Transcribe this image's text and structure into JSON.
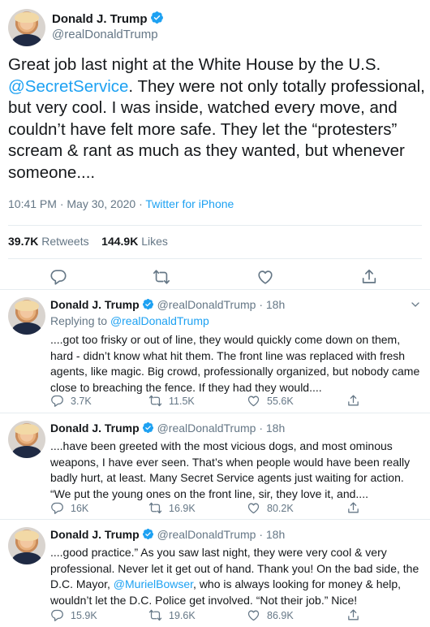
{
  "main_tweet": {
    "author_name": "Donald J. Trump",
    "author_handle": "@realDonaldTrump",
    "text_part1": "Great job last night at the White House by the U.S. ",
    "mention": "@SecretService",
    "text_part2": ". They were not only totally professional, but very cool. I was inside, watched every move, and couldn’t have felt more safe. They let the “protesters” scream & rant as much as they wanted, but whenever someone....",
    "timestamp": "10:41 PM · May 30, 2020 · ",
    "source": "Twitter for iPhone",
    "retweets_count": "39.7K",
    "retweets_label": "Retweets",
    "likes_count": "144.9K",
    "likes_label": "Likes"
  },
  "replies": [
    {
      "author_name": "Donald J. Trump",
      "author_handle": "@realDonaldTrump",
      "time": "18h",
      "replying_prefix": "Replying to ",
      "replying_handle": "@realDonaldTrump",
      "text": "....got too frisky or out of line, they would quickly come down on them, hard - didn’t know what hit them. The front line was replaced with fresh agents, like magic. Big crowd, professionally organized, but nobody came close to breaching the fence. If they had they would....",
      "reply_count": "3.7K",
      "retweet_count": "11.5K",
      "like_count": "55.6K"
    },
    {
      "author_name": "Donald J. Trump",
      "author_handle": "@realDonaldTrump",
      "time": "18h",
      "text": "....have been greeted with the most vicious dogs, and most ominous weapons, I have ever seen. That’s when people would have been really badly hurt, at least. Many Secret Service agents just waiting for action. “We put the young ones on the front line, sir, they love it, and....",
      "reply_count": "16K",
      "retweet_count": "16.9K",
      "like_count": "80.2K"
    },
    {
      "author_name": "Donald J. Trump",
      "author_handle": "@realDonaldTrump",
      "time": "18h",
      "text_part1": "....good practice.” As you saw last night, they were very cool & very professional. Never let it get out of hand. Thank you! On the bad side, the D.C. Mayor, ",
      "mention": "@MurielBowser",
      "text_part2": ", who is always looking for money & help, wouldn’t let the D.C. Police get involved. “Not their job.” Nice!",
      "reply_count": "15.9K",
      "retweet_count": "19.6K",
      "like_count": "86.9K"
    }
  ],
  "colors": {
    "accent": "#1da1f2",
    "muted": "#657786",
    "text": "#14171a",
    "border": "#e6ecf0"
  },
  "icons": [
    "verified-badge-icon",
    "reply-icon",
    "retweet-icon",
    "like-icon",
    "share-icon",
    "chevron-down-icon"
  ]
}
